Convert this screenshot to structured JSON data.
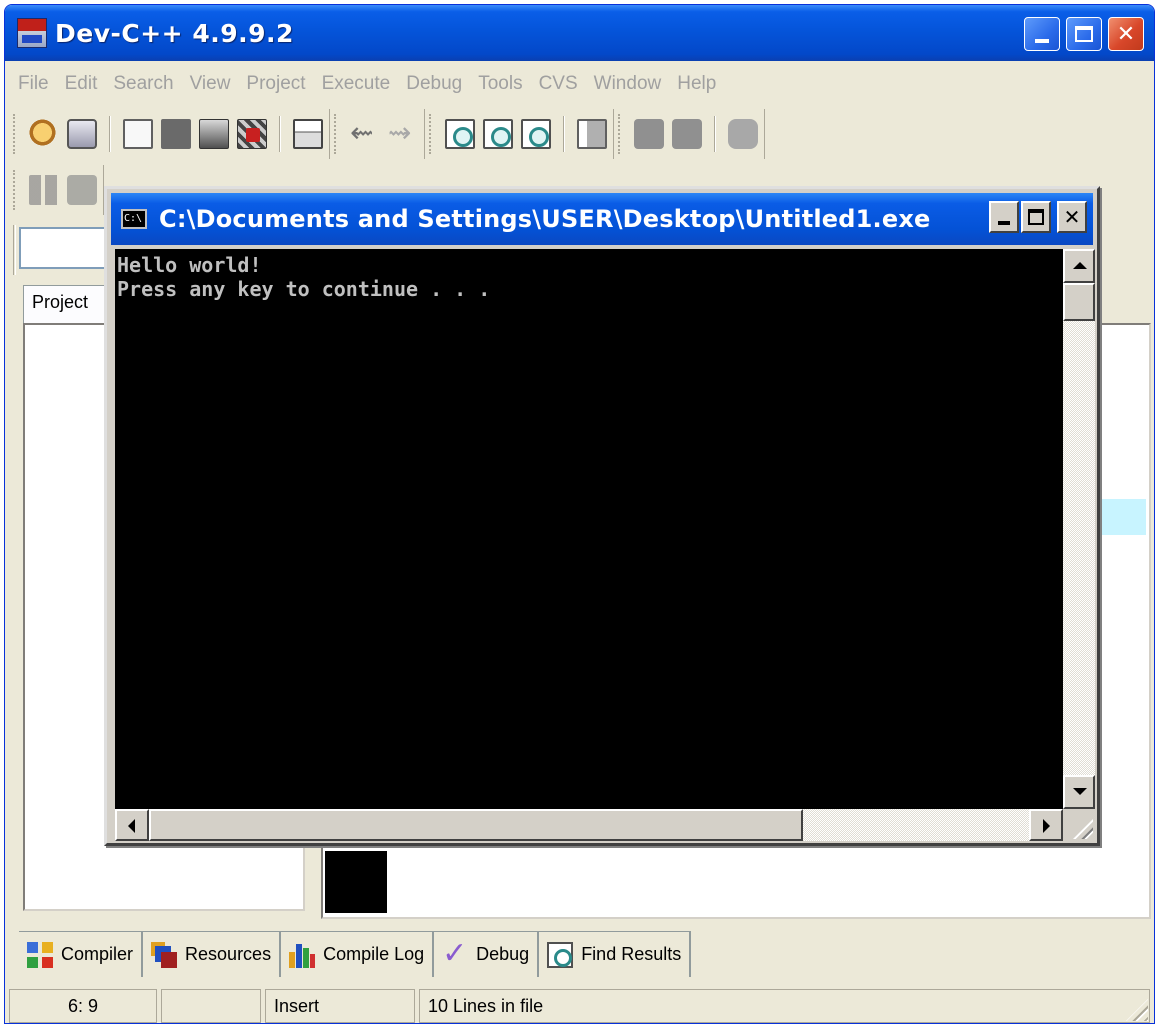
{
  "main_window": {
    "title": "Dev-C++ 4.9.9.2"
  },
  "menubar": {
    "items": [
      "File",
      "Edit",
      "Search",
      "View",
      "Project",
      "Execute",
      "Debug",
      "Tools",
      "CVS",
      "Window",
      "Help"
    ]
  },
  "toolbar": {
    "icons": [
      "open-project-icon",
      "save-icon",
      "new-file-icon",
      "new-file-dark-icon",
      "save-all-icon",
      "close-file-icon",
      "print-icon",
      "undo-icon",
      "redo-icon",
      "find-icon",
      "replace-icon",
      "find-next-icon",
      "goto-line-icon",
      "bookmark-icon",
      "bookmark-next-icon",
      "toggle-icon"
    ]
  },
  "left_panel": {
    "tab_label": "Project"
  },
  "console_window": {
    "title": "C:\\Documents and Settings\\USER\\Desktop\\Untitled1.exe",
    "output_lines": [
      "Hello world!",
      "Press any key to continue . . ."
    ]
  },
  "bottom_tabs": [
    {
      "label": "Compiler",
      "icon": "compiler-icon"
    },
    {
      "label": "Resources",
      "icon": "resources-icon"
    },
    {
      "label": "Compile Log",
      "icon": "compile-log-icon"
    },
    {
      "label": "Debug",
      "icon": "debug-icon"
    },
    {
      "label": "Find Results",
      "icon": "find-results-icon"
    }
  ],
  "statusbar": {
    "position": "6: 9",
    "empty": "",
    "mode": "Insert",
    "lines": "10 Lines in file"
  },
  "colors": {
    "xp_title_blue": "#0453d8",
    "console_bg": "#000000",
    "console_text": "#c0c0c0",
    "window_face": "#ece9d8"
  }
}
